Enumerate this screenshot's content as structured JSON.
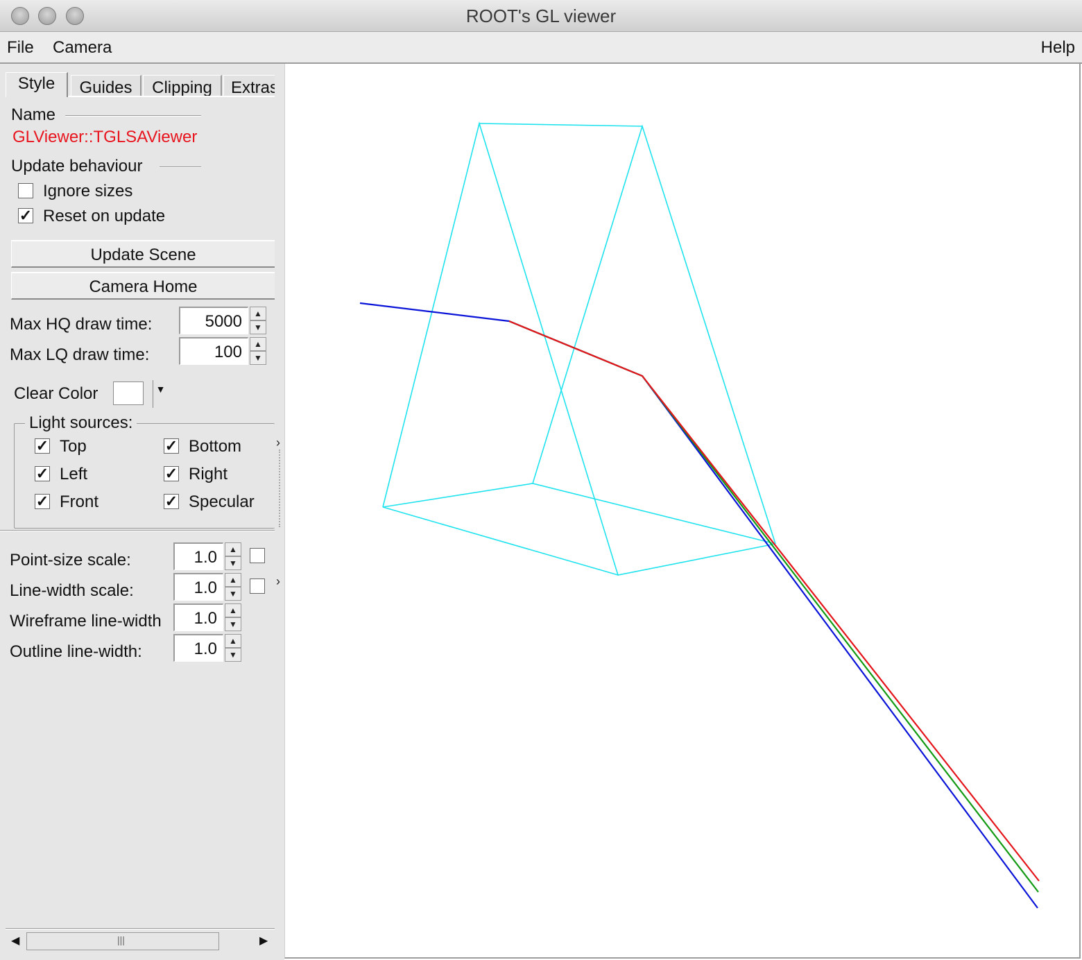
{
  "window": {
    "title": "ROOT's GL viewer"
  },
  "menu": {
    "file": "File",
    "camera": "Camera",
    "help": "Help"
  },
  "tabs": [
    {
      "label": "Style"
    },
    {
      "label": "Guides"
    },
    {
      "label": "Clipping"
    },
    {
      "label": "Extras"
    }
  ],
  "style": {
    "name_label": "Name",
    "name_value": "GLViewer::TGLSAViewer",
    "update_behaviour_label": "Update behaviour",
    "ignore_sizes": {
      "label": "Ignore sizes",
      "checked": false
    },
    "reset_on_update": {
      "label": "Reset on update",
      "checked": true
    },
    "update_scene_button": "Update Scene",
    "camera_home_button": "Camera Home",
    "max_hq": {
      "label": "Max HQ draw time:",
      "value": "5000"
    },
    "max_lq": {
      "label": "Max LQ draw time:",
      "value": "100"
    },
    "clear_color_label": "Clear Color",
    "clear_color": "#ffffff",
    "light_sources_label": "Light sources:",
    "lights": [
      {
        "label": "Top",
        "checked": true
      },
      {
        "label": "Bottom",
        "checked": true
      },
      {
        "label": "Left",
        "checked": true
      },
      {
        "label": "Right",
        "checked": true
      },
      {
        "label": "Front",
        "checked": true
      },
      {
        "label": "Specular",
        "checked": true
      }
    ],
    "point_size_scale": {
      "label": "Point-size scale:",
      "value": "1.0",
      "checked": false
    },
    "line_width_scale": {
      "label": "Line-width scale:",
      "value": "1.0",
      "checked": false
    },
    "wireframe_line_width": {
      "label": "Wireframe line-width",
      "value": "1.0"
    },
    "outline_line_width": {
      "label": "Outline line-width:",
      "value": "1.0"
    }
  },
  "scene": {
    "colors": {
      "wireframe": "#1ee3ee",
      "blue": "#0a14d8",
      "red": "#e4141a",
      "green": "#129a12"
    }
  }
}
